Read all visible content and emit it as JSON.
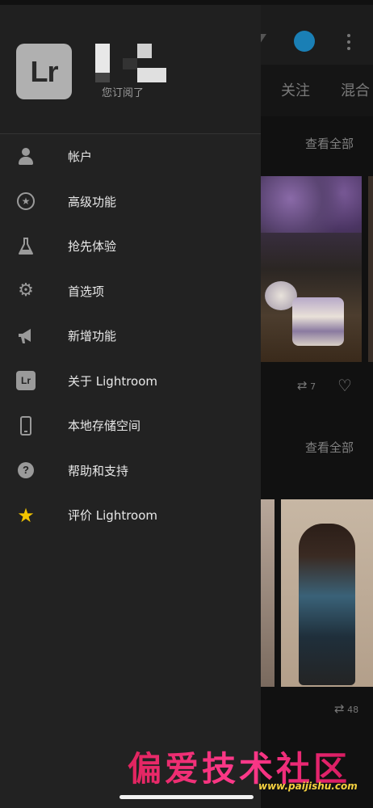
{
  "background": {
    "tabs": [
      "关注",
      "混合"
    ],
    "view_all_1": "查看全部",
    "view_all_2": "查看全部",
    "stats_1": "7",
    "stats_2": "48"
  },
  "drawer": {
    "logo": "Lr",
    "subscription_label": "您订阅了",
    "menu": [
      {
        "label": "帐户",
        "icon": "user-icon"
      },
      {
        "label": "高级功能",
        "icon": "star-circle-icon"
      },
      {
        "label": "抢先体验",
        "icon": "flask-icon"
      },
      {
        "label": "首选项",
        "icon": "gear-icon"
      },
      {
        "label": "新增功能",
        "icon": "megaphone-icon"
      },
      {
        "label": "关于 Lightroom",
        "icon": "lightroom-icon"
      },
      {
        "label": "本地存储空间",
        "icon": "phone-icon"
      },
      {
        "label": "帮助和支持",
        "icon": "help-icon"
      },
      {
        "label": "评价 Lightroom",
        "icon": "star-icon"
      }
    ]
  },
  "watermark": {
    "text": "偏爱技术社区",
    "url": "www.paijishu.com"
  },
  "colors": {
    "drawer_bg": "#222222",
    "rate_star": "#f2c500",
    "avatar_accent": "#1a7fb5"
  }
}
